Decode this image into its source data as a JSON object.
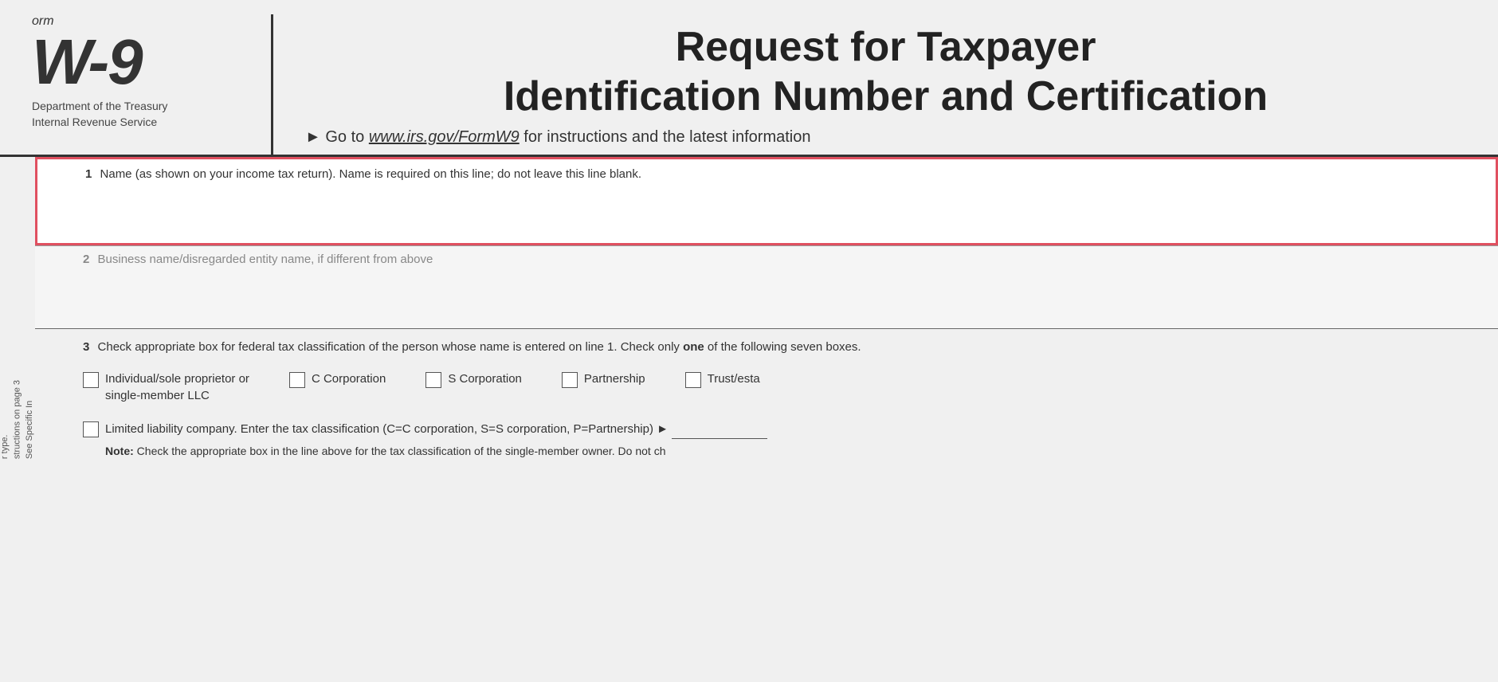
{
  "header": {
    "form_prefix": "orm",
    "form_number": "W-9",
    "department_line1": "Department of the Treasury",
    "department_line2": "Internal Revenue Service",
    "main_title_line1": "Request for Taxpayer",
    "main_title_line2": "Identification Number and Certification",
    "subtitle": "► Go to www.irs.gov/FormW9 for instructions and the latest information"
  },
  "fields": {
    "field1": {
      "number": "1",
      "label": "Name (as shown on your income tax return). Name is required on this line; do not leave this line blank."
    },
    "field2": {
      "number": "2",
      "label": "Business name/disregarded entity name, if different from above"
    },
    "field3": {
      "number": "3",
      "label": "Check appropriate box for federal tax classification of the person whose name is entered on line 1. Check only one of the following seven boxes."
    }
  },
  "checkboxes": [
    {
      "id": "individual",
      "label": "Individual/sole proprietor or single-member LLC"
    },
    {
      "id": "c_corp",
      "label": "C Corporation"
    },
    {
      "id": "s_corp",
      "label": "S Corporation"
    },
    {
      "id": "partnership",
      "label": "Partnership"
    },
    {
      "id": "trust",
      "label": "Trust/esta"
    }
  ],
  "llc_row": {
    "checkbox_label": "",
    "text": "Limited liability company. Enter the tax classification (C=C corporation, S=S corporation, P=Partnership) ►",
    "note_bold": "Note:",
    "note_text": " Check the appropriate box in the line above for the tax classification of the single-member owner.  Do not ch"
  },
  "sidebar": {
    "line1": "r type.",
    "line2": "structions on page 3",
    "page_label": "See Specific In"
  }
}
